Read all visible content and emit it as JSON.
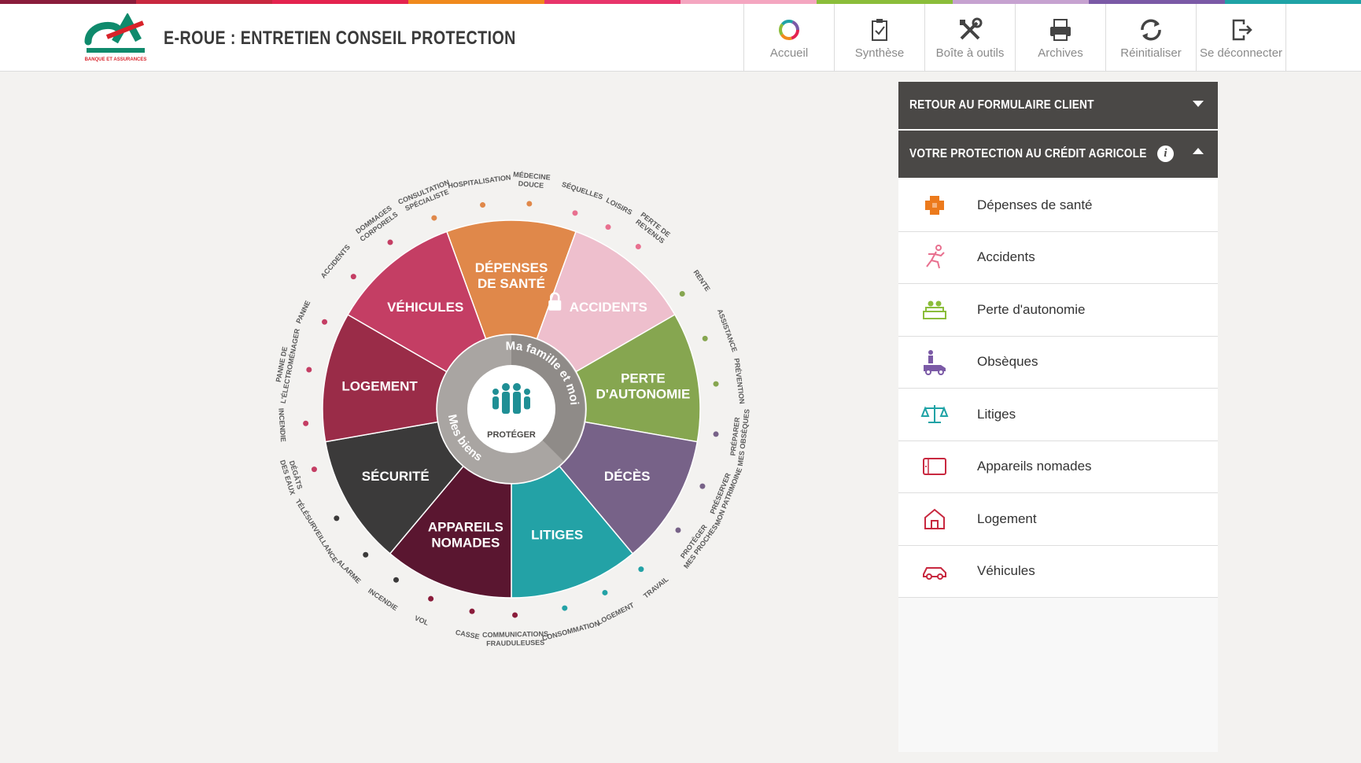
{
  "stripe_colors": [
    "#8a1c3b",
    "#c8283f",
    "#e4234f",
    "#f08a1d",
    "#e8356b",
    "#f4a6c0",
    "#8bbd3a",
    "#c6a2d0",
    "#7b5aa6",
    "#1fa3a6"
  ],
  "header": {
    "title": "E-ROUE : ENTRETIEN CONSEIL PROTECTION",
    "logo_text": "CA",
    "logo_caption": "BANQUE ET ASSURANCES"
  },
  "nav": [
    {
      "label": "Accueil",
      "icon": "ring-icon"
    },
    {
      "label": "Synthèse",
      "icon": "clipboard-check-icon"
    },
    {
      "label": "Boîte à outils",
      "icon": "tools-icon"
    },
    {
      "label": "Archives",
      "icon": "printer-icon"
    },
    {
      "label": "Réinitialiser",
      "icon": "refresh-icon"
    },
    {
      "label": "Se déconnecter",
      "icon": "logout-icon"
    }
  ],
  "wheel": {
    "center_label": "PROTÉGER",
    "ring_top": "Ma famille et moi",
    "ring_bottom": "Mes biens",
    "segments": [
      {
        "lines": [
          "DÉPENSES",
          "DE SANTÉ"
        ],
        "color": "#e0884a"
      },
      {
        "lines": [
          "ACCIDENTS"
        ],
        "color": "#eebfcd",
        "locked": true
      },
      {
        "lines": [
          "PERTE",
          "D'AUTONOMIE"
        ],
        "color": "#86a650"
      },
      {
        "lines": [
          "DÉCÈS"
        ],
        "color": "#776288"
      },
      {
        "lines": [
          "LITIGES"
        ],
        "color": "#23a2a6"
      },
      {
        "lines": [
          "APPAREILS",
          "NOMADES"
        ],
        "color": "#5a1630"
      },
      {
        "lines": [
          "SÉCURITÉ"
        ],
        "color": "#3b3a3a"
      },
      {
        "lines": [
          "LOGEMENT"
        ],
        "color": "#9a2c48"
      },
      {
        "lines": [
          "VÉHICULES"
        ],
        "color": "#c43e64"
      }
    ],
    "outer_labels": [
      {
        "lines": [
          "MÉDECINE",
          "DOUCE"
        ],
        "color": "#e0884a",
        "angle": 5
      },
      {
        "lines": [
          "HOSPITALISATION"
        ],
        "color": "#e0884a",
        "angle": -8
      },
      {
        "lines": [
          "CONSULTATION",
          "SPÉCIALISTE"
        ],
        "color": "#e0884a",
        "angle": -22
      },
      {
        "lines": [
          "SÉQUELLES"
        ],
        "color": "#e8708f",
        "angle": 18
      },
      {
        "lines": [
          "LOISIRS"
        ],
        "color": "#e8708f",
        "angle": 28
      },
      {
        "lines": [
          "PERTE DE",
          "REVENUS"
        ],
        "color": "#e8708f",
        "angle": 38
      },
      {
        "lines": [
          "RENTE"
        ],
        "color": "#86a650",
        "angle": 56
      },
      {
        "lines": [
          "ASSISTANCE"
        ],
        "color": "#86a650",
        "angle": 70
      },
      {
        "lines": [
          "PRÉVENTION"
        ],
        "color": "#86a650",
        "angle": 83
      },
      {
        "lines": [
          "PRÉPARER",
          "MES OBSÈQUES"
        ],
        "color": "#776288",
        "angle": 97
      },
      {
        "lines": [
          "PRÉSERVER",
          "MON PATRIMOINE"
        ],
        "color": "#776288",
        "angle": 112
      },
      {
        "lines": [
          "PROTÉGER",
          "MES PROCHES"
        ],
        "color": "#776288",
        "angle": 126
      },
      {
        "lines": [
          "TRAVAIL"
        ],
        "color": "#23a2a6",
        "angle": 141
      },
      {
        "lines": [
          "LOGEMENT"
        ],
        "color": "#23a2a6",
        "angle": 153
      },
      {
        "lines": [
          "CONSOMMATION"
        ],
        "color": "#23a2a6",
        "angle": 165
      },
      {
        "lines": [
          "COMMUNICATIONS",
          "FRAUDULEUSES"
        ],
        "color": "#8a1c3b",
        "angle": 179
      },
      {
        "lines": [
          "CASSE"
        ],
        "color": "#8a1c3b",
        "angle": 191
      },
      {
        "lines": [
          "VOL"
        ],
        "color": "#8a1c3b",
        "angle": 203
      },
      {
        "lines": [
          "INCENDIE"
        ],
        "color": "#3b3a3a",
        "angle": 214
      },
      {
        "lines": [
          "ALARME"
        ],
        "color": "#3b3a3a",
        "angle": 225
      },
      {
        "lines": [
          "TÉLÉSURVEILLANCE"
        ],
        "color": "#3b3a3a",
        "angle": 238
      },
      {
        "lines": [
          "DÉGÂTS",
          "DES EAUX"
        ],
        "color": "#c43e64",
        "angle": 253
      },
      {
        "lines": [
          "INCENDIE"
        ],
        "color": "#c43e64",
        "angle": 266
      },
      {
        "lines": [
          "PANNE DE",
          "L'ÉLECTROMÉNAGER"
        ],
        "color": "#c43e64",
        "angle": 281
      },
      {
        "lines": [
          "PANNE"
        ],
        "color": "#c43e64",
        "angle": 295
      },
      {
        "lines": [
          "ACCIDENTS"
        ],
        "color": "#c43e64",
        "angle": 310
      },
      {
        "lines": [
          "DOMMAGES",
          "CORPORELS"
        ],
        "color": "#c43e64",
        "angle": 324
      }
    ]
  },
  "panel": {
    "back_label": "RETOUR AU FORMULAIRE CLIENT",
    "section_label": "VOTRE PROTECTION AU CRÉDIT AGRICOLE",
    "items": [
      {
        "label": "Dépenses de santé",
        "icon": "health-cross-icon",
        "color": "#ec7a1c"
      },
      {
        "label": "Accidents",
        "icon": "running-person-icon",
        "color": "#e8708f"
      },
      {
        "label": "Perte d'autonomie",
        "icon": "people-sofa-icon",
        "color": "#8bbd3a"
      },
      {
        "label": "Obsèques",
        "icon": "hearse-icon",
        "color": "#7b5aa6"
      },
      {
        "label": "Litiges",
        "icon": "scales-icon",
        "color": "#1fa3a6"
      },
      {
        "label": "Appareils nomades",
        "icon": "tablet-icon",
        "color": "#c8283f"
      },
      {
        "label": "Logement",
        "icon": "house-icon",
        "color": "#c8283f"
      },
      {
        "label": "Véhicules",
        "icon": "car-icon",
        "color": "#c8283f"
      }
    ]
  }
}
